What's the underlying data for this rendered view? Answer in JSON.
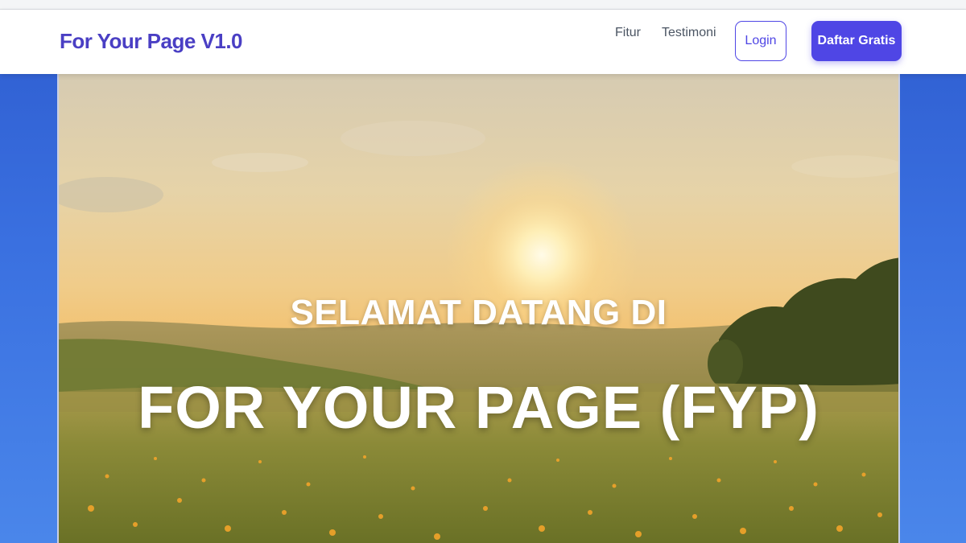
{
  "navbar": {
    "brand": "For Your Page V1.0",
    "links": [
      "Fitur",
      "Testimoni"
    ],
    "login_label": "Login",
    "signup_label": "Daftar Gratis"
  },
  "hero": {
    "subtitle": "SELAMAT DATANG DI",
    "title": "FOR YOUR PAGE (FYP)",
    "background": "sunset-meadow-image"
  },
  "colors": {
    "brand": "#4a3fc4",
    "accent": "#4f46e5",
    "page_background": "#3a70e0"
  }
}
